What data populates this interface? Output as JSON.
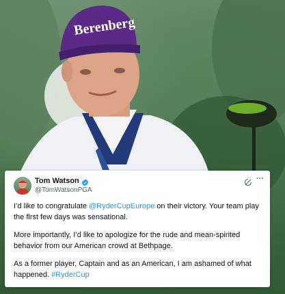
{
  "photo": {
    "cap_text": "Berenberg"
  },
  "tweet": {
    "display_name": "Tom Watson",
    "handle": "@TomWatsonPGA",
    "para1_before": "I’d like to congratulate ",
    "para1_mention": "@RyderCupEurope",
    "para1_after": " on their victory. Your team play the first few days was sensational.",
    "para2": "More importantly, I’d like to apologize for the rude and mean-spirited behavior from our American crowd at Bethpage.",
    "para3_before": "As a former player, Captain and as an American, I am ashamed of what happened. ",
    "para3_hashtag": "#RyderCup",
    "more_glyph": "···"
  },
  "colors": {
    "link": "#1d9bf0",
    "verified": "#1d9bf0",
    "cap": "#5b2a86"
  },
  "icons": [
    "verified-badge-icon",
    "grok-rewrite-icon",
    "more-options-icon"
  ]
}
